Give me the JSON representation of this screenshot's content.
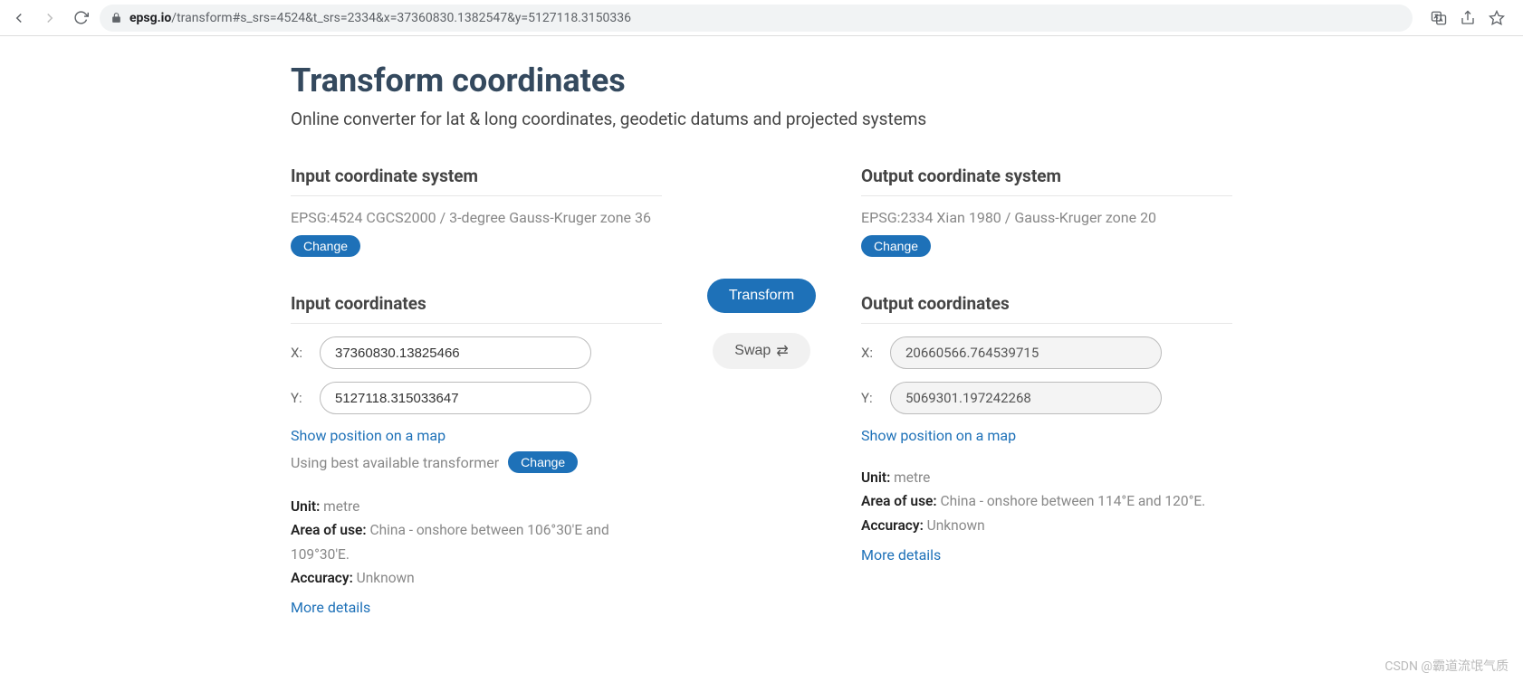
{
  "browser": {
    "url_host": "epsg.io",
    "url_path": "/transform#s_srs=4524&t_srs=2334&x=37360830.1382547&y=5127118.3150336"
  },
  "page": {
    "title": "Transform coordinates",
    "subtitle": "Online converter for lat & long coordinates, geodetic datums and projected systems"
  },
  "input_system": {
    "heading": "Input coordinate system",
    "crs": "EPSG:4524 CGCS2000 / 3-degree Gauss-Kruger zone 36",
    "change": "Change"
  },
  "output_system": {
    "heading": "Output coordinate system",
    "crs": "EPSG:2334 Xian 1980 / Gauss-Kruger zone 20",
    "change": "Change"
  },
  "input_coords": {
    "heading": "Input coordinates",
    "x_label": "X:",
    "y_label": "Y:",
    "x": "37360830.13825466",
    "y": "5127118.315033647",
    "show_map": "Show position on a map",
    "transformer_note": "Using best available transformer",
    "transformer_change": "Change",
    "unit_label": "Unit:",
    "unit": "metre",
    "area_label": "Area of use:",
    "area": "China - onshore between 106°30'E and 109°30'E.",
    "accuracy_label": "Accuracy:",
    "accuracy": "Unknown",
    "more": "More details"
  },
  "output_coords": {
    "heading": "Output coordinates",
    "x_label": "X:",
    "y_label": "Y:",
    "x": "20660566.764539715",
    "y": "5069301.197242268",
    "show_map": "Show position on a map",
    "unit_label": "Unit:",
    "unit": "metre",
    "area_label": "Area of use:",
    "area": "China - onshore between 114°E and 120°E.",
    "accuracy_label": "Accuracy:",
    "accuracy": "Unknown",
    "more": "More details"
  },
  "actions": {
    "transform": "Transform",
    "swap": "Swap"
  },
  "watermark": "CSDN @霸道流氓气质"
}
